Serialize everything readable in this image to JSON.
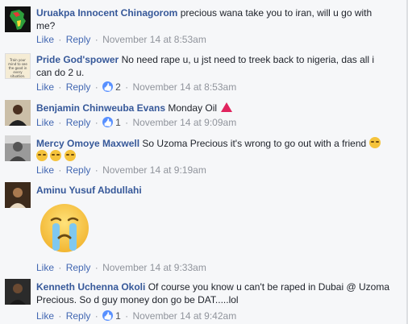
{
  "common": {
    "like": "Like",
    "reply": "Reply",
    "sep": "·"
  },
  "comments": [
    {
      "author": "Uruakpa Innocent Chinagorom",
      "text": "precious wana take you to iran, will u go with me?",
      "time": "November 14 at 8:53am",
      "reactions": ""
    },
    {
      "author": "Pride God'spower",
      "text": "No need rape u, u jst need to treek back to nigeria, das all i can do 2 u.",
      "time": "November 14 at 8:53am",
      "reactions": "2"
    },
    {
      "author": "Benjamin Chinweuba Evans",
      "text": "Monday Oil",
      "time": "November 14 at 9:09am",
      "reactions": "1"
    },
    {
      "author": "Mercy Omoye Maxwell",
      "text": "So Uzoma Precious it's wrong to go out with a friend",
      "time": "November 14 at 9:19am",
      "reactions": ""
    },
    {
      "author": "Aminu Yusuf Abdullahi",
      "text": "",
      "time": "November 14 at 9:33am",
      "reactions": ""
    },
    {
      "author": "Kenneth Uchenna Okoli",
      "text": "Of course you know u can't be raped in Dubai @ Uzoma Precious. So d guy money don go be DAT.....lol",
      "time": "November 14 at 9:42am",
      "reactions": "1"
    }
  ],
  "avatar_text": {
    "pride": "Train your mind to see the good in every situation."
  },
  "colors": {
    "link": "#365899",
    "action": "#4267b2",
    "meta": "#90949c",
    "background": "#f6f7f9"
  },
  "icons": {
    "reaction": "thumbs-up-icon",
    "emoji_small": "smirk-emoji-icon",
    "triangle": "red-triangle-icon",
    "big_emoji": "crying-face-emoji-icon"
  }
}
